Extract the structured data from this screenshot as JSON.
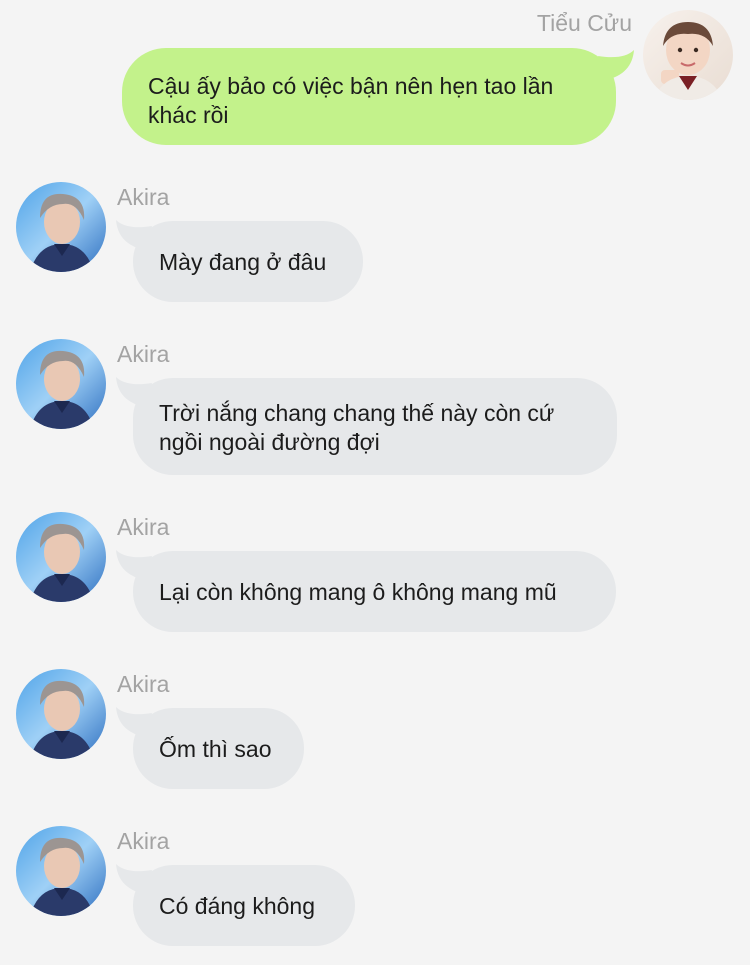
{
  "conversation": {
    "self": {
      "name": "Tiểu Cửu",
      "avatar_icon": "profile-photo-icon",
      "bubble_color": "#c3f28b",
      "message": "Cậu ấy bảo có việc bận nên hẹn tao lần khác rồi"
    },
    "other": {
      "name": "Akira",
      "avatar_icon": "profile-photo-icon",
      "bubble_color": "#e6e8ea"
    },
    "messages": [
      {
        "sender": "Akira",
        "text": "Mày đang ở đâu"
      },
      {
        "sender": "Akira",
        "text": "Trời nắng chang chang thế này còn cứ ngồi ngoài đường đợi"
      },
      {
        "sender": "Akira",
        "text": "Lại còn không mang ô không mang mũ"
      },
      {
        "sender": "Akira",
        "text": "Ốm thì sao"
      },
      {
        "sender": "Akira",
        "text": "Có đáng không"
      }
    ]
  }
}
